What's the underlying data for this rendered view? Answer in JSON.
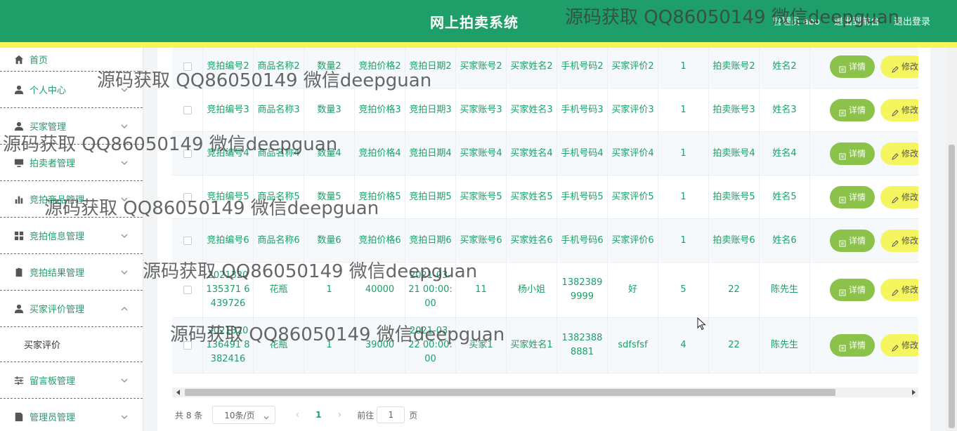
{
  "header": {
    "title": "网上拍卖系统",
    "admin_label": "管理员 abo",
    "back_label": "退出到前台",
    "logout_label": "退出登录"
  },
  "sidebar": {
    "items": [
      {
        "label": "首页",
        "icon": "home-icon"
      },
      {
        "label": "个人中心",
        "icon": "user-icon"
      },
      {
        "label": "买家管理",
        "icon": "user-icon"
      },
      {
        "label": "拍卖者管理",
        "icon": "monitor-icon"
      },
      {
        "label": "竞拍商品管理",
        "icon": "bar-chart-icon"
      },
      {
        "label": "竞拍信息管理",
        "icon": "grid-icon"
      },
      {
        "label": "竞拍结果管理",
        "icon": "clipboard-icon"
      },
      {
        "label": "买家评价管理",
        "icon": "user-icon"
      },
      {
        "label": "留言板管理",
        "icon": "sliders-icon"
      },
      {
        "label": "管理员管理",
        "icon": "document-icon"
      }
    ],
    "sub_items": [
      {
        "label": "买家评价"
      }
    ]
  },
  "table": {
    "rows": [
      [
        "竞拍编号2",
        "商品名称2",
        "数量2",
        "竞拍价格2",
        "竞拍日期2",
        "买家账号2",
        "买家姓名2",
        "手机号码2",
        "买家评价2",
        "1",
        "拍卖账号2",
        "姓名2"
      ],
      [
        "竞拍编号3",
        "商品名称3",
        "数量3",
        "竞拍价格3",
        "竞拍日期3",
        "买家账号3",
        "买家姓名3",
        "手机号码3",
        "买家评价3",
        "1",
        "拍卖账号3",
        "姓名3"
      ],
      [
        "竞拍编号4",
        "商品名称4",
        "数量4",
        "竞拍价格4",
        "竞拍日期4",
        "买家账号4",
        "买家姓名4",
        "手机号码4",
        "买家评价4",
        "1",
        "拍卖账号4",
        "姓名4"
      ],
      [
        "竞拍编号5",
        "商品名称5",
        "数量5",
        "竞拍价格5",
        "竞拍日期5",
        "买家账号5",
        "买家姓名5",
        "手机号码5",
        "买家评价5",
        "1",
        "拍卖账号5",
        "姓名5"
      ],
      [
        "竞拍编号6",
        "商品名称6",
        "数量6",
        "竞拍价格6",
        "竞拍日期6",
        "买家账号6",
        "买家姓名6",
        "手机号码6",
        "买家评价6",
        "1",
        "拍卖账号6",
        "姓名6"
      ],
      [
        "2021320135371 6439726",
        "花瓶",
        "1",
        "40000",
        "2021-03-21 00:00:00",
        "11",
        "杨小姐",
        "13823899999",
        "好",
        "5",
        "22",
        "陈先生"
      ],
      [
        "2021320136491 8382416",
        "花瓶",
        "1",
        "39000",
        "2021-03-22 00:00:00",
        "买家1",
        "买家姓名1",
        "13823888881",
        "sdfsfsf",
        "4",
        "22",
        "陈先生"
      ]
    ],
    "detail_label": "详情",
    "edit_label": "修改"
  },
  "pagination": {
    "total": "共 8 条",
    "page_size": "10条/页",
    "current_page": "1",
    "goto_label": "前往",
    "goto_value": "1",
    "page_suffix": "页"
  },
  "watermark": "源码获取 QQ86050149 微信deepguan",
  "colors": {
    "brand": "#1e9e68",
    "accent_stripe": "#f3f55a",
    "detail_button": "#8bc34a",
    "edit_button": "#f5f55f"
  }
}
